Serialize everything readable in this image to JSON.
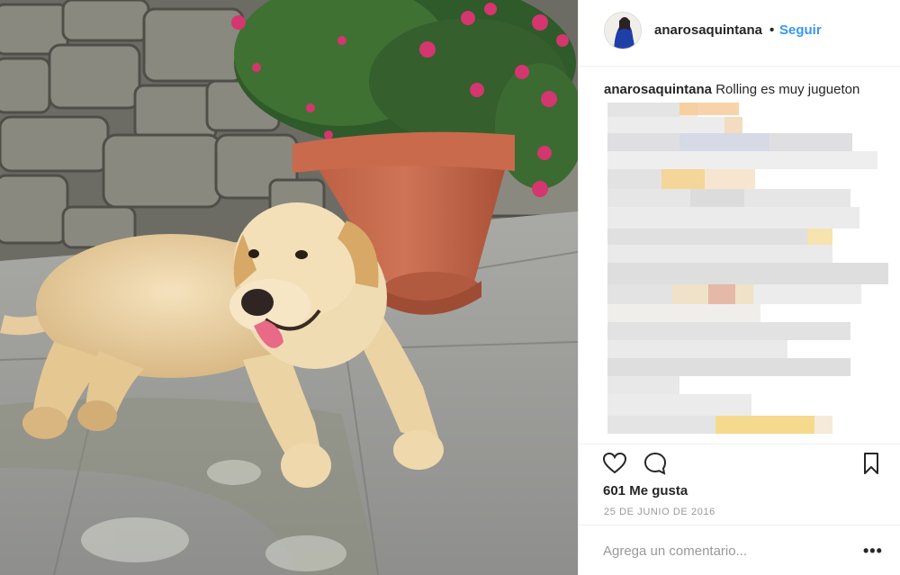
{
  "post": {
    "username": "anarosaquintana",
    "separator": "•",
    "follow_label": "Seguir",
    "caption_text": "Rolling es muy jugueton",
    "likes_text": "601 Me gusta",
    "date_text": "25 DE JUNIO DE 2016",
    "comment_placeholder": "Agrega un comentario...",
    "more_label": "•••"
  },
  "icons": [
    "heart-icon",
    "comment-icon",
    "bookmark-icon",
    "more-options-icon"
  ],
  "colors": {
    "link": "#3897f0",
    "text": "#262626",
    "muted": "#999999",
    "divider": "#efefef"
  }
}
